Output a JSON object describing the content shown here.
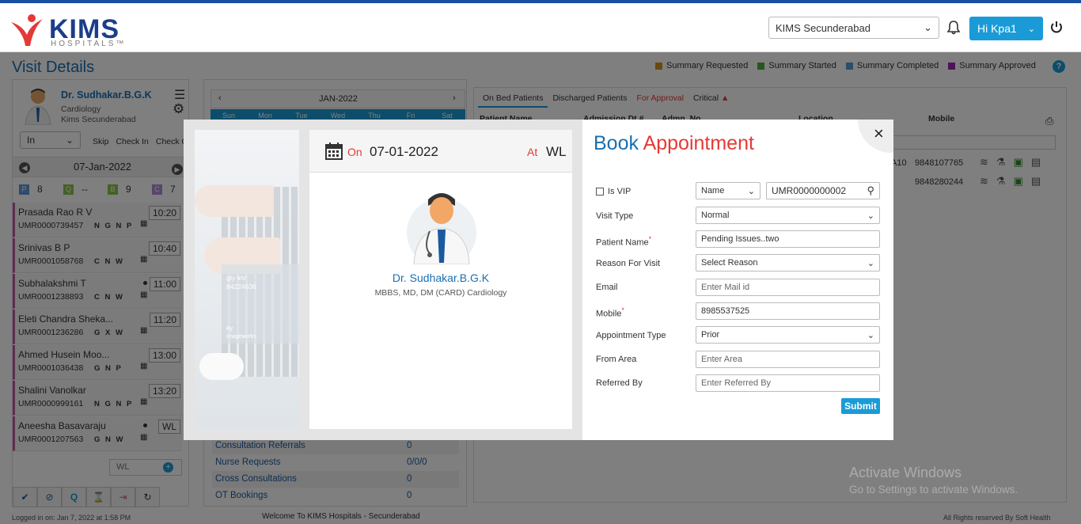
{
  "header": {
    "logo_text": "KIMS",
    "logo_sub": "HOSPITALS™",
    "location_select": "KIMS Secunderabad",
    "user_button": "Hi Kpa1"
  },
  "page": {
    "title": "Visit Details",
    "legend": [
      {
        "label": "Summary Requested",
        "color": "#d4931e"
      },
      {
        "label": "Summary Started",
        "color": "#4caf3a"
      },
      {
        "label": "Summary Completed",
        "color": "#5b9bd5"
      },
      {
        "label": "Summary Approved",
        "color": "#9c27b0"
      }
    ]
  },
  "doctor": {
    "name": "Dr. Sudhakar.B.G.K",
    "dept": "Cardiology",
    "location": "Kims Secunderabad",
    "status_select": "In",
    "actions": [
      "Skip",
      "Check In",
      "Check Out"
    ],
    "date": "07-Jan-2022",
    "counts": [
      {
        "badge": "P",
        "value": "8",
        "color": "#5b9bd5"
      },
      {
        "badge": "Q",
        "value": "--",
        "color": "#8bc34a"
      },
      {
        "badge": "B",
        "value": "9",
        "color": "#8bc34a"
      },
      {
        "badge": "C",
        "value": "7",
        "color": "#b28ad6"
      }
    ]
  },
  "patients": [
    {
      "name": "Prasada Rao R V",
      "umr": "UMR0000739457",
      "flags": "N G N P",
      "time": "10:20",
      "dot": false
    },
    {
      "name": "Srinivas B P",
      "umr": "UMR0001058768",
      "flags": "C N W",
      "time": "10:40",
      "dot": false
    },
    {
      "name": "Subhalakshmi T",
      "umr": "UMR0001238893",
      "flags": "C N W",
      "time": "11:00",
      "dot": true
    },
    {
      "name": "Eleti Chandra Sheka...",
      "umr": "UMR0001236286",
      "flags": "G X W",
      "time": "11:20",
      "dot": false
    },
    {
      "name": "Ahmed Husein Moo...",
      "umr": "UMR0001036438",
      "flags": "G N P",
      "time": "13:00",
      "dot": false
    },
    {
      "name": "Shalini Vanolkar",
      "umr": "UMR0000999161",
      "flags": "N G N P",
      "time": "13:20",
      "dot": false
    },
    {
      "name": "Aneesha Basavaraju",
      "umr": "UMR0001207563",
      "flags": "G N W",
      "time": "WL",
      "dot": true
    }
  ],
  "wl_input": "WL",
  "calendar": {
    "month": "JAN-2022",
    "days": [
      "Sun",
      "Mon",
      "Tue",
      "Wed",
      "Thu",
      "Fri",
      "Sat"
    ]
  },
  "requests": [
    {
      "label": "Consultation Referrals",
      "value": "0"
    },
    {
      "label": "Nurse Requests",
      "value": "0/0/0"
    },
    {
      "label": "Cross Consultations",
      "value": "0"
    },
    {
      "label": "OT Bookings",
      "value": "0"
    }
  ],
  "tabs": [
    "On Bed Patients",
    "Discharged Patients",
    "For Approval",
    "Critical"
  ],
  "columns": [
    "Patient Name",
    "Admission Dt #",
    "Admn. No",
    "Location",
    "Mobile"
  ],
  "bed_rows": [
    {
      "frag": "A10",
      "mobile": "9848107765"
    },
    {
      "frag": "",
      "mobile": "9848280244"
    }
  ],
  "footer": {
    "logged_in": "Logged in on: Jan 7, 2022 at 1:58 PM",
    "welcome": "Welcome To KIMS Hospitals - Secunderabad",
    "rights": "All Rights reserved By Soft Health"
  },
  "watermark": {
    "line1": "Activate Windows",
    "line2": "Go to Settings to activate Windows."
  },
  "modal": {
    "photo_text1": "gty im/",
    "photo_text2": "84224636",
    "photo_text3": "By",
    "photo_text4": "Imageworks",
    "on_label": "On",
    "date": "07-01-2022",
    "at_label": "At",
    "at_value": "WL",
    "doctor_name": "Dr. Sudhakar.B.G.K",
    "doctor_quals": "MBBS, MD, DM (CARD) Cardiology",
    "title_part1": "Book",
    "title_part2": "Appointment",
    "is_vip": "Is VIP",
    "search_type": "Name",
    "search_value": "UMR0000000002",
    "labels": {
      "visit_type": "Visit Type",
      "patient_name": "Patient Name",
      "reason": "Reason For Visit",
      "email": "Email",
      "mobile": "Mobile",
      "appt_type": "Appointment Type",
      "from_area": "From Area",
      "referred_by": "Referred By"
    },
    "values": {
      "visit_type": "Normal",
      "patient_name": "Pending Issues..two",
      "reason": "Select Reason",
      "email_ph": "Enter Mail id",
      "mobile": "8985537525",
      "appt_type": "Prior",
      "from_area_ph": "Enter Area",
      "referred_by_ph": "Enter Referred By"
    },
    "submit": "Submit",
    "close": "×"
  }
}
